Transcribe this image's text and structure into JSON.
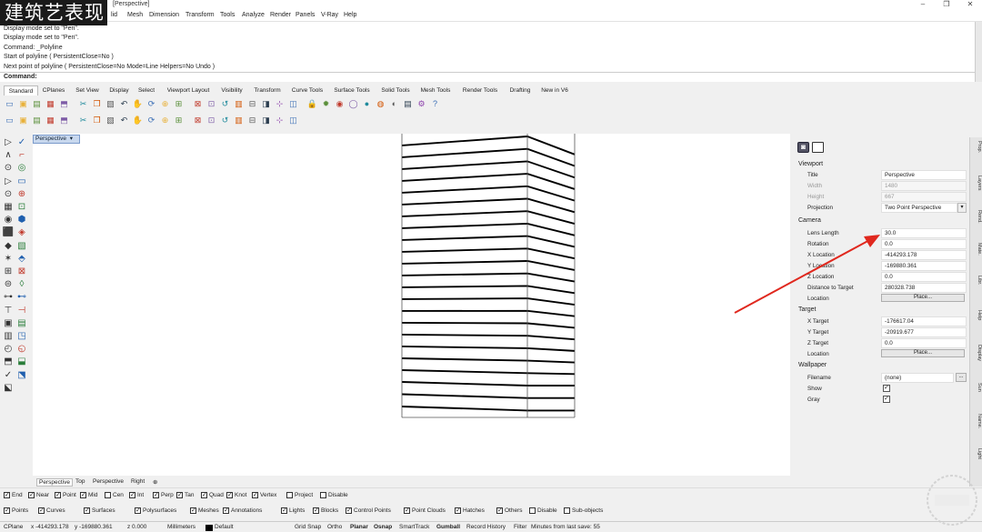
{
  "watermark": {
    "text": "建筑艺表现"
  },
  "window": {
    "title": "[Perspective]",
    "minimize": "–",
    "maximize": "❐",
    "close": "✕"
  },
  "menu": {
    "items": [
      "lid",
      "Mesh",
      "Dimension",
      "Transform",
      "Tools",
      "Analyze",
      "Render",
      "Panels",
      "V-Ray",
      "Help"
    ]
  },
  "command_history": {
    "lines": [
      "Display mode set to \"Pen\".",
      "Display mode set to \"Pen\".",
      "Command: _Polyline",
      "Start of polyline ( PersistentClose=No )",
      "Next point of polyline ( PersistentClose=No  Mode=Line  Helpers=No  Undo )"
    ],
    "prompt": "Command:"
  },
  "toolbar_tabs": [
    "Standard",
    "CPlanes",
    "Set View",
    "Display",
    "Select",
    "Viewport Layout",
    "Visibility",
    "Transform",
    "Curve Tools",
    "Surface Tools",
    "Solid Tools",
    "Mesh Tools",
    "Render Tools",
    "Drafting",
    "New in V6"
  ],
  "toolbar_row1_icons": [
    "new-icon",
    "open-icon",
    "save-icon",
    "print-icon",
    "import-icon",
    "cut-icon",
    "copy-icon",
    "paste-icon",
    "undo-icon",
    "pan-icon",
    "rotate-view-icon",
    "zoom-icon",
    "zoom-window-icon",
    "zoom-extents-icon",
    "zoom-selected-icon",
    "undo-view-icon",
    "viewports-icon",
    "four-view-icon",
    "object-properties-icon",
    "cplane-icon",
    "named-view-icon",
    "lock-icon",
    "light-icon",
    "material-icon",
    "wireframe-icon",
    "shaded-icon",
    "rendered-icon",
    "render-icon",
    "layer-icon",
    "options-icon",
    "help-icon"
  ],
  "toolbar_row2_icons": [
    "select-icon",
    "teapot-icon",
    "render-preview-icon",
    "printer-icon",
    "sun-icon",
    "lens-icon",
    "dimension-icon",
    "grid-icon",
    "snap-icon",
    "record-icon",
    "section-icon",
    "spiral-icon",
    "light-bulb-icon",
    "spot-icon",
    "texture-icon",
    "box-edit-icon",
    "move-icon",
    "rotate-icon",
    "plant-icon",
    "gumball-icon",
    "clipping-icon"
  ],
  "left_tools": [
    "▷",
    "✓",
    "∧",
    "⌐",
    "⊙",
    "◎",
    "▷",
    "▭",
    "⊙",
    "⊕",
    "▦",
    "⊡",
    "◉",
    "⬢",
    "⬛",
    "◈",
    "◆",
    "▧",
    "✶",
    "⬘",
    "⊞",
    "⊠",
    "⊜",
    "◊",
    "⊶",
    "⊷",
    "⊤",
    "⊣",
    "▣",
    "▤",
    "▥",
    "◳",
    "◴",
    "◵",
    "⬒",
    "⬓",
    "✓",
    "⬔",
    "⬕"
  ],
  "viewport": {
    "label": "Perspective",
    "dropdown": "▾",
    "tabs": [
      "Perspective",
      "Top",
      "Perspective",
      "Right",
      "⊕"
    ]
  },
  "panel": {
    "icons": [
      "camera-icon",
      "view-icon"
    ],
    "viewport_section": "Viewport",
    "title_label": "Title",
    "title_value": "Perspective",
    "width_label": "Width",
    "width_value": "1480",
    "height_label": "Height",
    "height_value": "667",
    "projection_label": "Projection",
    "projection_value": "Two Point Perspective",
    "camera_section": "Camera",
    "lens_label": "Lens Length",
    "lens_value": "30.0",
    "rotation_label": "Rotation",
    "rotation_value": "0.0",
    "xloc_label": "X Location",
    "xloc_value": "-414293.178",
    "yloc_label": "Y Location",
    "yloc_value": "-169880.361",
    "zloc_label": "Z Location",
    "zloc_value": "0.0",
    "dist_label": "Distance to Target",
    "dist_value": "280328.738",
    "cam_location_label": "Location",
    "place_button": "Place...",
    "target_section": "Target",
    "xt_label": "X Target",
    "xt_value": "-176617.04",
    "yt_label": "Y Target",
    "yt_value": "-20919.677",
    "zt_label": "Z Target",
    "zt_value": "0.0",
    "target_location_label": "Location",
    "target_place_button": "Place...",
    "wallpaper_section": "Wallpaper",
    "filename_label": "Filename",
    "filename_value": "(none)",
    "browse_button": "...",
    "show_label": "Show",
    "gray_label": "Gray"
  },
  "right_tabs": [
    "Prop.",
    "Layers",
    "Rend.",
    "Mate.",
    "Libr.",
    "Help",
    "Display",
    "Sun",
    "Name.",
    "Light"
  ],
  "osnaps": [
    {
      "label": "End",
      "checked": true
    },
    {
      "label": "Near",
      "checked": true
    },
    {
      "label": "Point",
      "checked": true
    },
    {
      "label": "Mid",
      "checked": true
    },
    {
      "label": "Cen",
      "checked": false
    },
    {
      "label": "Int",
      "checked": true
    },
    {
      "label": "Perp",
      "checked": true
    },
    {
      "label": "Tan",
      "checked": true
    },
    {
      "label": "Quad",
      "checked": true
    },
    {
      "label": "Knot",
      "checked": true
    },
    {
      "label": "Vertex",
      "checked": true
    },
    {
      "label": "Project",
      "checked": false
    },
    {
      "label": "Disable",
      "checked": false
    }
  ],
  "select_filters": [
    {
      "label": "Points",
      "checked": true
    },
    {
      "label": "Curves",
      "checked": true
    },
    {
      "label": "Surfaces",
      "checked": true
    },
    {
      "label": "Polysurfaces",
      "checked": true
    },
    {
      "label": "Meshes",
      "checked": true
    },
    {
      "label": "Annotations",
      "checked": true
    },
    {
      "label": "Lights",
      "checked": true
    },
    {
      "label": "Blocks",
      "checked": true
    },
    {
      "label": "Control Points",
      "checked": true
    },
    {
      "label": "Point Clouds",
      "checked": true
    },
    {
      "label": "Hatches",
      "checked": true
    },
    {
      "label": "Others",
      "checked": true
    },
    {
      "label": "Disable",
      "checked": false
    },
    {
      "label": "Sub-objects",
      "checked": false
    }
  ],
  "status": {
    "cplane": "CPlane",
    "x": "x -414293.178",
    "y": "y -169880.361",
    "z": "z 0.000",
    "units": "Millimeters",
    "layer": "Default",
    "grid_snap": "Grid Snap",
    "ortho": "Ortho",
    "planar": "Planar",
    "osnap": "Osnap",
    "smarttrack": "SmartTrack",
    "gumball": "Gumball",
    "record": "Record History",
    "filter": "Filter",
    "save": "Minutes from last save: 55"
  },
  "colors": {
    "accent_red": "#e0281e",
    "tab_active": "#ffffff",
    "viewport_bg": "#ffffff"
  }
}
